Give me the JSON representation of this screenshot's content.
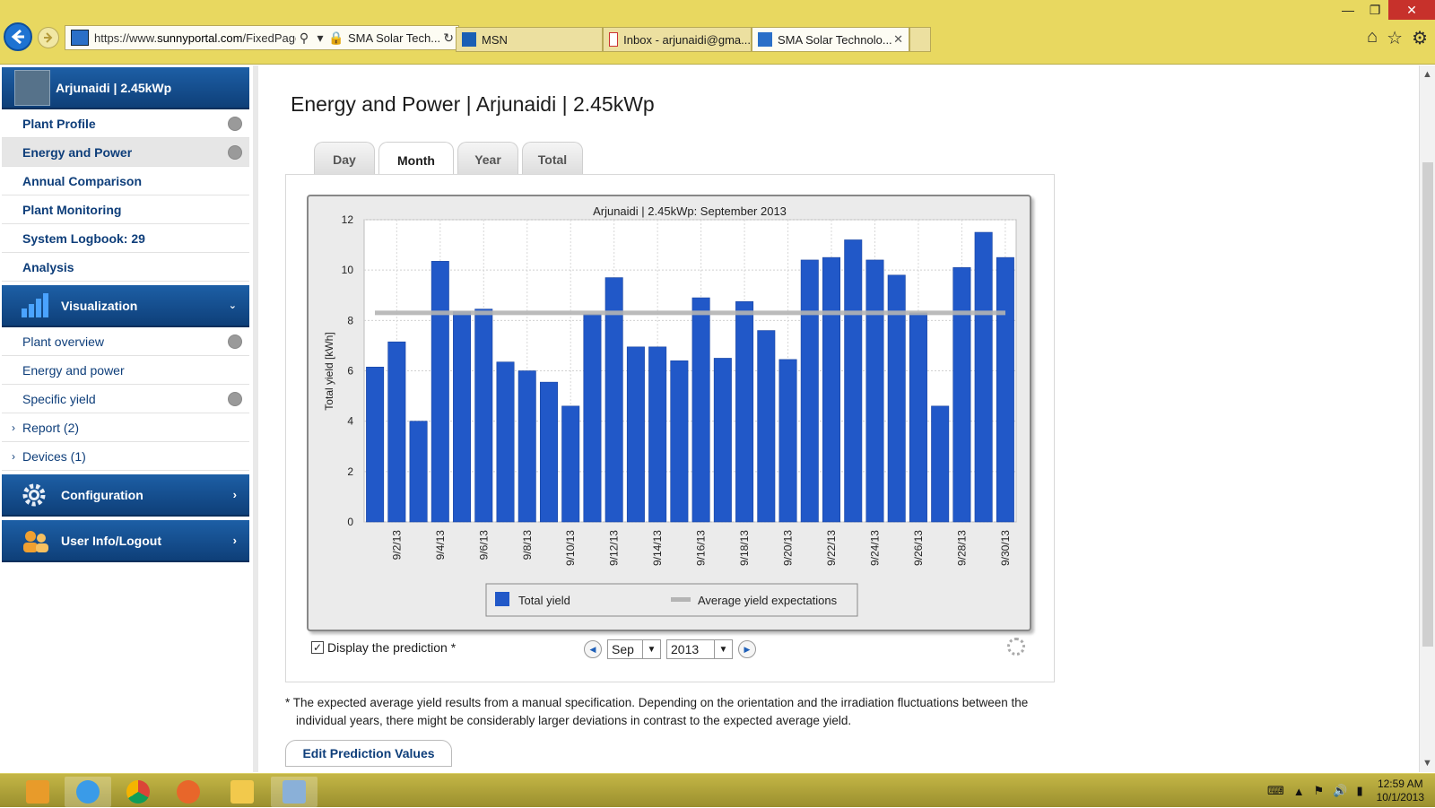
{
  "browser": {
    "url_prefix": "https://www.",
    "url_host": "sunnyportal.com",
    "url_path": "/FixedPage",
    "site_security": "SMA Solar Tech...",
    "tabs": [
      {
        "label": "MSN"
      },
      {
        "label": "Inbox - arjunaidi@gma..."
      },
      {
        "label": "SMA Solar Technolo..."
      }
    ]
  },
  "sidebar": {
    "plant_name": "Arjunaidi | 2.45kWp",
    "items": [
      {
        "label": "Plant Profile"
      },
      {
        "label": "Energy and Power"
      },
      {
        "label": "Annual Comparison"
      },
      {
        "label": "Plant Monitoring"
      },
      {
        "label": "System Logbook: 29"
      },
      {
        "label": "Analysis"
      }
    ],
    "visualization": {
      "label": "Visualization",
      "items": [
        {
          "label": "Plant overview"
        },
        {
          "label": "Energy and power"
        },
        {
          "label": "Specific yield"
        },
        {
          "label": "Report (2)"
        },
        {
          "label": "Devices (1)"
        }
      ]
    },
    "configuration_label": "Configuration",
    "userinfo_label": "User Info/Logout"
  },
  "main": {
    "title": "Energy and Power | Arjunaidi | 2.45kWp",
    "tabs": [
      {
        "label": "Day"
      },
      {
        "label": "Month"
      },
      {
        "label": "Year"
      },
      {
        "label": "Total"
      }
    ],
    "prediction_label": "Display the prediction *",
    "month_value": "Sep",
    "year_value": "2013",
    "footnote_line1": "* The expected average yield results from a manual specification. Depending on the orientation and the irradiation fluctuations between the",
    "footnote_line2": "individual years, there might be considerably larger deviations in contrast to the expected average yield.",
    "edit_button": "Edit Prediction Values"
  },
  "chart_data": {
    "type": "bar",
    "title": "Arjunaidi | 2.45kWp: September 2013",
    "ylabel": "Total yield [kWh]",
    "xlabel": "",
    "ylim": [
      0,
      12
    ],
    "yticks": [
      0,
      2,
      4,
      6,
      8,
      10,
      12
    ],
    "categories": [
      "9/1/13",
      "9/2/13",
      "9/3/13",
      "9/4/13",
      "9/5/13",
      "9/6/13",
      "9/7/13",
      "9/8/13",
      "9/9/13",
      "9/10/13",
      "9/11/13",
      "9/12/13",
      "9/13/13",
      "9/14/13",
      "9/15/13",
      "9/16/13",
      "9/17/13",
      "9/18/13",
      "9/19/13",
      "9/20/13",
      "9/21/13",
      "9/22/13",
      "9/23/13",
      "9/24/13",
      "9/25/13",
      "9/26/13",
      "9/27/13",
      "9/28/13",
      "9/29/13",
      "9/30/13"
    ],
    "tick_labels_shown": [
      "9/2/13",
      "9/4/13",
      "9/6/13",
      "9/8/13",
      "9/10/13",
      "9/12/13",
      "9/14/13",
      "9/16/13",
      "9/18/13",
      "9/20/13",
      "9/22/13",
      "9/24/13",
      "9/26/13",
      "9/28/13",
      "9/30/13"
    ],
    "series": [
      {
        "name": "Total yield",
        "color": "#2158c8",
        "values": [
          6.15,
          7.15,
          4.0,
          10.35,
          8.35,
          8.45,
          6.35,
          6.0,
          5.55,
          4.6,
          8.25,
          9.7,
          6.95,
          6.95,
          6.4,
          8.9,
          6.5,
          8.75,
          7.6,
          6.45,
          10.4,
          10.5,
          11.2,
          10.4,
          9.8,
          8.3,
          4.6,
          10.1,
          11.5,
          10.5
        ]
      },
      {
        "name": "Average yield expectations",
        "color": "#b4b4b4",
        "type": "line",
        "values": [
          8.3
        ]
      }
    ],
    "grid": true,
    "legend": "bottom"
  },
  "taskbar": {
    "time": "12:59 AM",
    "date": "10/1/2013"
  }
}
